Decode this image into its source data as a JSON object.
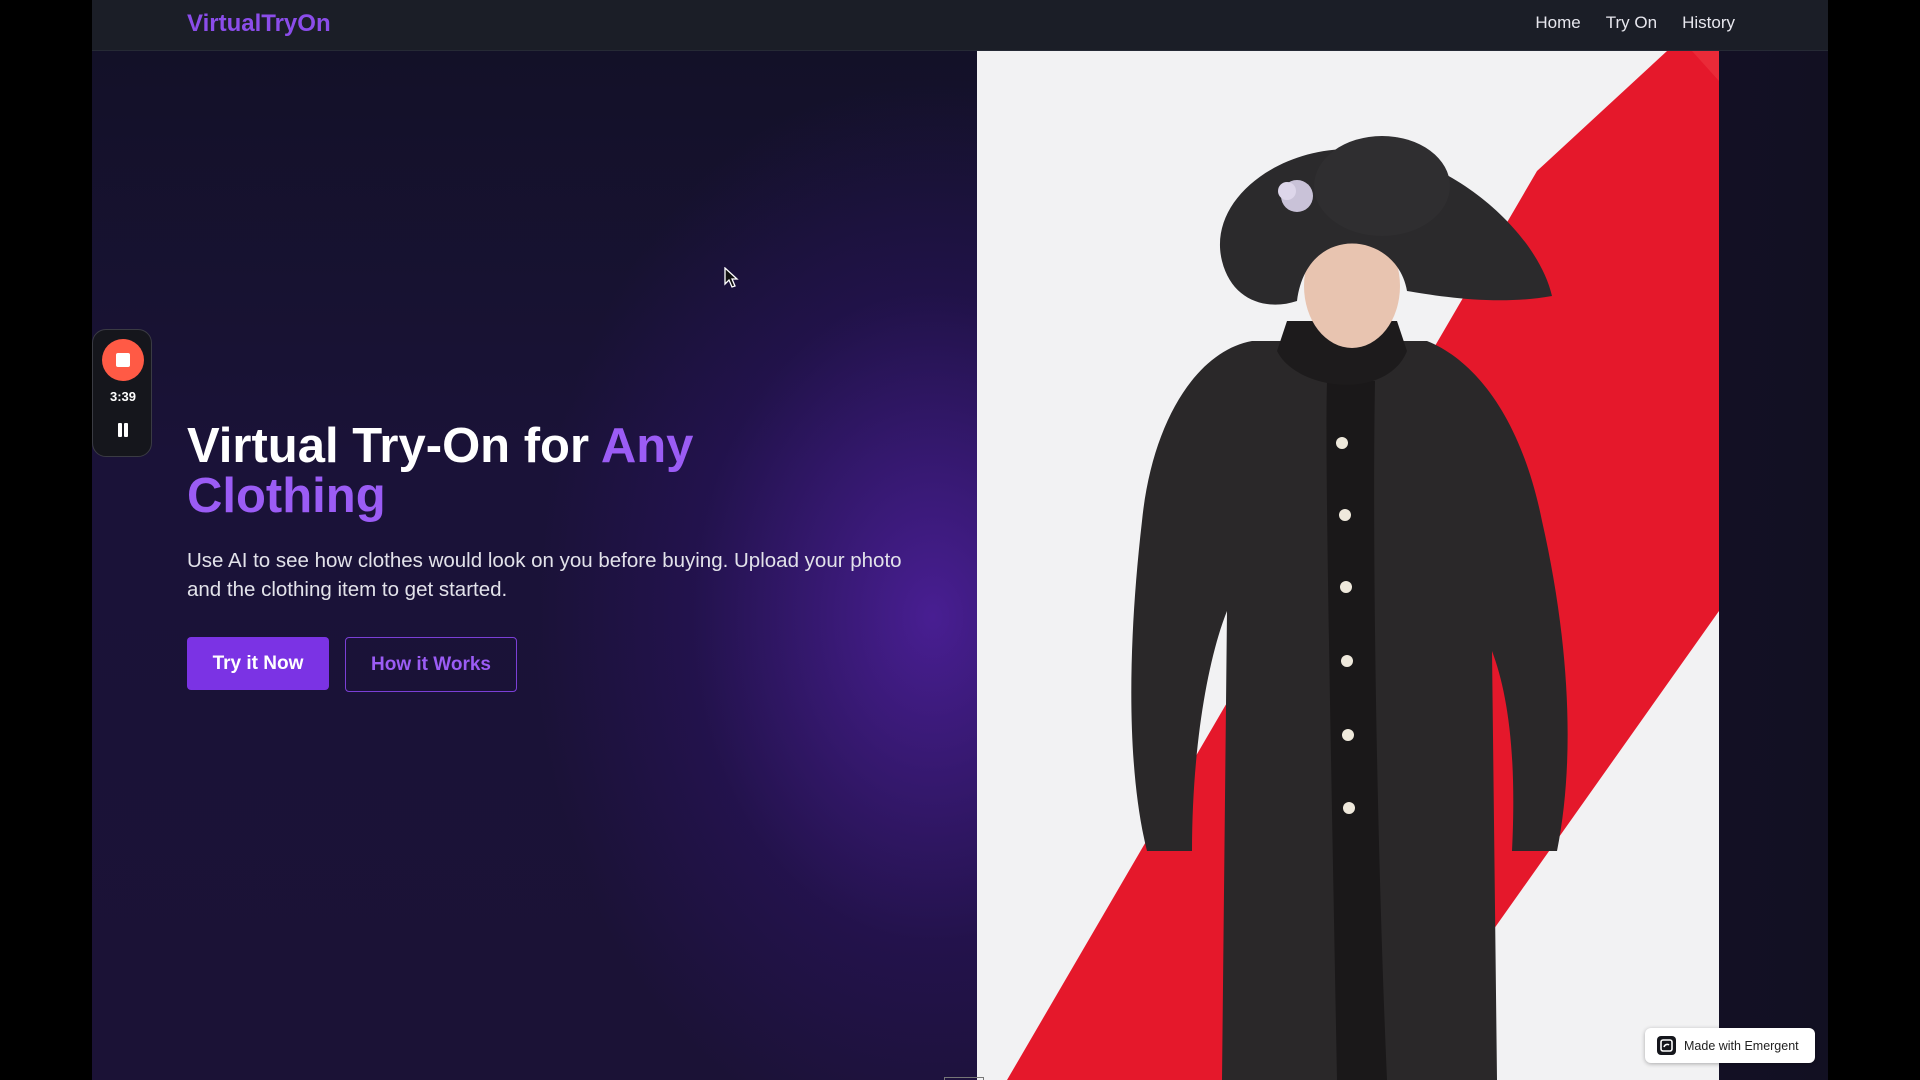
{
  "app": {
    "brand": "VirtualTryOn"
  },
  "nav": {
    "links": [
      "Home",
      "Try On",
      "History"
    ]
  },
  "hero": {
    "title_prefix": "Virtual Try-On for ",
    "title_accent": "Any Clothing",
    "description": "Use AI to see how clothes would look on you before buying. Upload your photo and the clothing item to get started.",
    "primary_cta": "Try it Now",
    "secondary_cta": "How it Works"
  },
  "recorder": {
    "elapsed": "3:39"
  },
  "badge": {
    "label": "Made with Emergent"
  },
  "colors": {
    "accent": "#8b4dea",
    "button": "#7b33e4",
    "record": "#ff5a45",
    "photo_stripe": "#e5182b"
  },
  "icons": [
    "stop-icon",
    "pause-icon",
    "mouse-cursor-icon",
    "emergent-logo-icon"
  ]
}
